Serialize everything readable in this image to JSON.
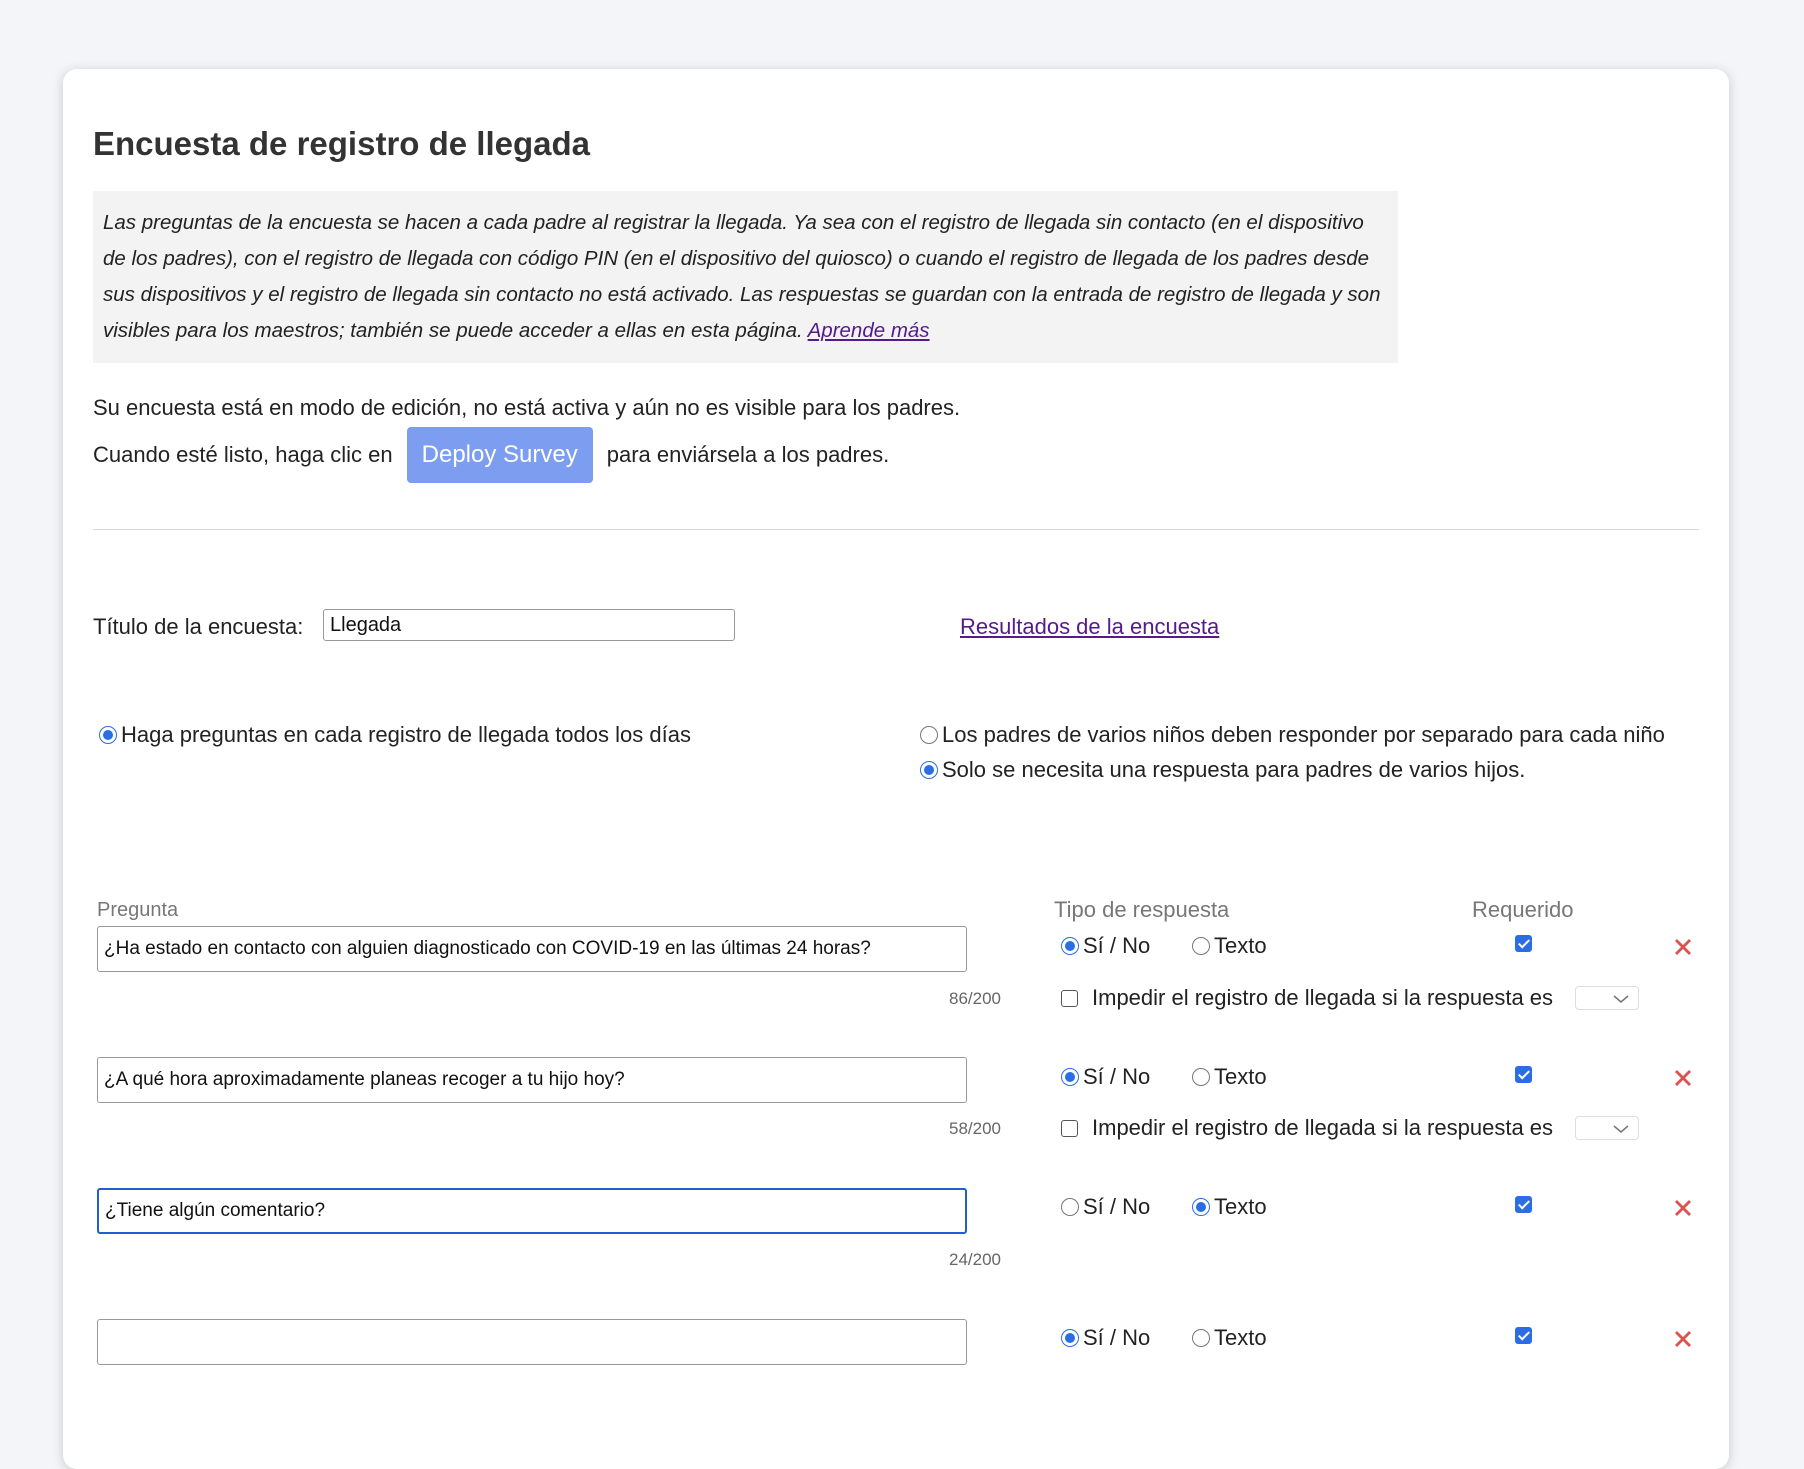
{
  "page": {
    "title": "Encuesta de registro de llegada",
    "info_text": "Las preguntas de la encuesta se hacen a cada padre al registrar la llegada. Ya sea con el registro de llegada sin contacto (en el dispositivo de los padres), con el registro de llegada con código PIN (en el dispositivo del quiosco) o cuando el registro de llegada de los padres desde sus dispositivos y el registro de llegada sin contacto no está activado. Las respuestas se guardan con la entrada de registro de llegada y son visibles para los maestros; también se puede acceder a ellas en esta página.",
    "learn_more": "Aprende más",
    "status_line1": "Su encuesta está en modo de edición, no está activa y aún no es visible para los padres.",
    "status_line2_before": "Cuando esté listo, haga clic en",
    "deploy_button": "Deploy Survey",
    "status_line2_after": "para enviársela a los padres."
  },
  "form": {
    "survey_title_label": "Título de la encuesta:",
    "survey_title_value": "Llegada",
    "results_link": "Resultados de la encuesta",
    "frequency_option": "Haga preguntas en cada registro de llegada todos los días",
    "multi_child_separate": "Los padres de varios niños deben responder por separado para cada niño",
    "multi_child_single": "Solo se necesita una respuesta para padres de varios hijos."
  },
  "table": {
    "col_question": "Pregunta",
    "col_type": "Tipo de respuesta",
    "col_required": "Requerido",
    "opt_yes_no": "Sí / No",
    "opt_text": "Texto",
    "block_checkin_label": "Impedir el registro de llegada si la respuesta es",
    "questions": [
      {
        "text": "¿Ha estado en contacto con alguien diagnosticado con COVID-19 en las últimas 24 horas?",
        "counter": "86/200",
        "type": "yesno",
        "required": true
      },
      {
        "text": "¿A qué hora aproximadamente planeas recoger a tu hijo hoy?",
        "counter": "58/200",
        "type": "yesno",
        "required": true
      },
      {
        "text": "¿Tiene algún comentario?",
        "counter": "24/200",
        "type": "text",
        "required": true
      },
      {
        "text": "",
        "counter": "",
        "type": "yesno",
        "required": true
      }
    ]
  },
  "colors": {
    "accent": "#2b6de5",
    "deploy_button_bg": "#7d9ef0",
    "link": "#551a8b",
    "delete": "#d9534f"
  }
}
